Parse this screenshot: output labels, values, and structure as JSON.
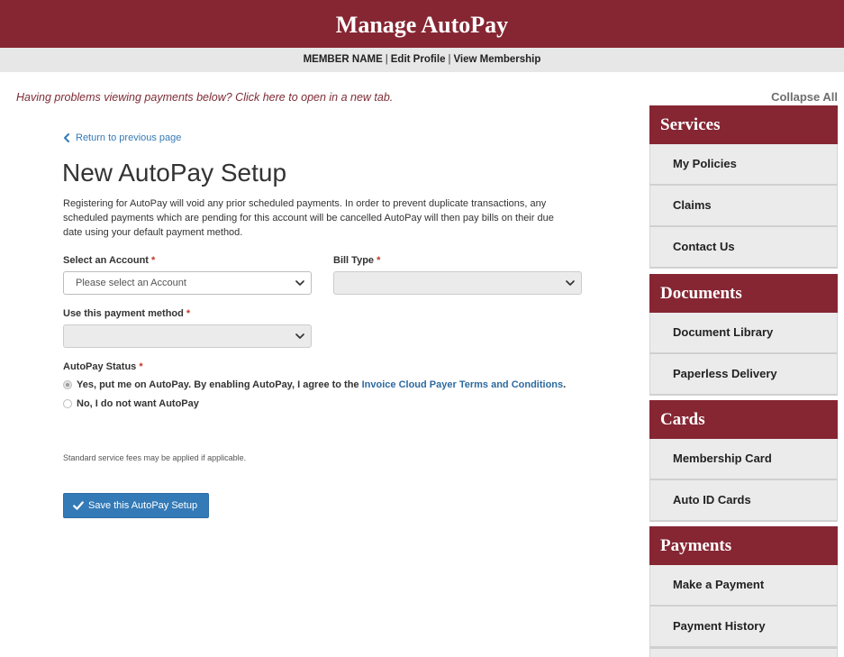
{
  "header": {
    "title": "Manage AutoPay"
  },
  "subnav": {
    "member_name": "MEMBER NAME",
    "separator": "|",
    "edit_profile": "Edit Profile",
    "view_membership": "View Membership"
  },
  "notice": "Having problems viewing payments below? Click here to open in a new tab.",
  "sidebar": {
    "collapse_all": "Collapse All",
    "sections": [
      {
        "title": "Services",
        "items": [
          "My Policies",
          "Claims",
          "Contact Us"
        ]
      },
      {
        "title": "Documents",
        "items": [
          "Document Library",
          "Paperless Delivery"
        ]
      },
      {
        "title": "Cards",
        "items": [
          "Membership Card",
          "Auto ID Cards"
        ]
      },
      {
        "title": "Payments",
        "items": [
          "Make a Payment",
          "Payment History"
        ]
      }
    ]
  },
  "main": {
    "return_link": {
      "icon": "chevron-left-icon",
      "label": "Return to previous page"
    },
    "title": "New AutoPay Setup",
    "intro_lines": [
      "Registering for AutoPay will void any prior scheduled payments. In order to prevent duplicate transactions, any",
      "scheduled payments which are pending for this account will be cancelled AutoPay will then pay bills on their due",
      "date using your default payment method."
    ],
    "required_mark": "*",
    "form": {
      "account": {
        "label": "Select an Account",
        "value": "Please select an Account",
        "icon": "chevron-down-icon",
        "disabled": false
      },
      "bill_type": {
        "label": "Bill Type",
        "icon": "chevron-down-icon",
        "disabled": true
      },
      "payment_method": {
        "label": "Use this payment method",
        "icon": "chevron-down-icon",
        "disabled": true
      },
      "autopay_status": {
        "label": "AutoPay Status",
        "options": [
          {
            "text": "Yes, put me on AutoPay. By enabling AutoPay, I agree to the ",
            "link": "Invoice Cloud Payer Terms and Conditions",
            "suffix": ".",
            "checked": true
          },
          {
            "text": "No, I do not want AutoPay",
            "checked": false
          }
        ]
      }
    },
    "fee_note": "Standard service fees may be applied if applicable.",
    "save_button": {
      "icon": "check-icon",
      "label": "Save this AutoPay Setup"
    }
  },
  "colors": {
    "brand": "#862633",
    "link": "#337ab7",
    "button": "#337ab7",
    "required": "#c0392b",
    "subnav_bg": "#e7e7e7",
    "item_bg": "#ebebeb"
  }
}
